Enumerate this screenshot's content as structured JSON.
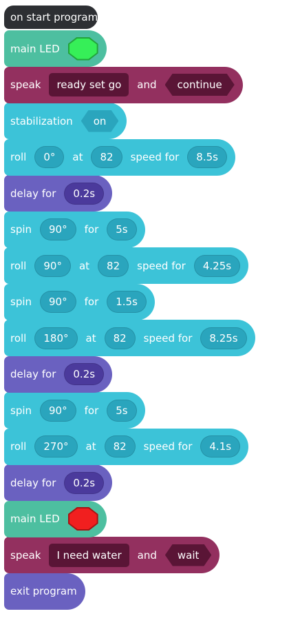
{
  "colors": {
    "event": "#2d2f33",
    "lights": "#4dbfa0",
    "sounds": "#93305f",
    "sounds_field": "#5a1536",
    "movement": "#3cc3d8",
    "movement_field": "#2aa5bd",
    "control": "#6a61c0",
    "control_field": "#4b3a9c",
    "green_led": "#36ef58",
    "green_led_border": "#22a33a",
    "red_led": "#f11f1f",
    "red_led_border": "#a81212"
  },
  "program": {
    "start_label": "on start program",
    "blocks": [
      {
        "id": "led1",
        "category": "lights",
        "parts": [
          {
            "t": "word",
            "v": "main LED"
          },
          {
            "t": "swatch",
            "color": "green_led",
            "border": "green_led_border",
            "icon": "green-led-swatch"
          }
        ]
      },
      {
        "id": "speak1",
        "category": "sounds",
        "parts": [
          {
            "t": "word",
            "v": "speak"
          },
          {
            "t": "str",
            "v": "ready set go"
          },
          {
            "t": "word",
            "v": "and"
          },
          {
            "t": "hex",
            "v": "continue"
          }
        ]
      },
      {
        "id": "stab",
        "category": "movement",
        "parts": [
          {
            "t": "word",
            "v": "stabilization"
          },
          {
            "t": "hex",
            "v": "on"
          }
        ]
      },
      {
        "id": "roll1",
        "category": "movement",
        "parts": [
          {
            "t": "word",
            "v": "roll"
          },
          {
            "t": "oval",
            "v": "0°"
          },
          {
            "t": "word",
            "v": "at"
          },
          {
            "t": "oval",
            "v": "82"
          },
          {
            "t": "word",
            "v": "speed for"
          },
          {
            "t": "oval",
            "v": "8.5s"
          }
        ]
      },
      {
        "id": "delay1",
        "category": "control",
        "parts": [
          {
            "t": "word",
            "v": "delay for"
          },
          {
            "t": "oval",
            "v": "0.2s"
          }
        ]
      },
      {
        "id": "spin1",
        "category": "movement",
        "parts": [
          {
            "t": "word",
            "v": "spin"
          },
          {
            "t": "oval",
            "v": "90°"
          },
          {
            "t": "word",
            "v": "for"
          },
          {
            "t": "oval",
            "v": "5s"
          }
        ]
      },
      {
        "id": "roll2",
        "category": "movement",
        "parts": [
          {
            "t": "word",
            "v": "roll"
          },
          {
            "t": "oval",
            "v": "90°"
          },
          {
            "t": "word",
            "v": "at"
          },
          {
            "t": "oval",
            "v": "82"
          },
          {
            "t": "word",
            "v": "speed for"
          },
          {
            "t": "oval",
            "v": "4.25s"
          }
        ]
      },
      {
        "id": "spin2",
        "category": "movement",
        "parts": [
          {
            "t": "word",
            "v": "spin"
          },
          {
            "t": "oval",
            "v": "90°"
          },
          {
            "t": "word",
            "v": "for"
          },
          {
            "t": "oval",
            "v": "1.5s"
          }
        ]
      },
      {
        "id": "roll3",
        "category": "movement",
        "parts": [
          {
            "t": "word",
            "v": "roll"
          },
          {
            "t": "oval",
            "v": "180°"
          },
          {
            "t": "word",
            "v": "at"
          },
          {
            "t": "oval",
            "v": "82"
          },
          {
            "t": "word",
            "v": "speed for"
          },
          {
            "t": "oval",
            "v": "8.25s"
          }
        ]
      },
      {
        "id": "delay2",
        "category": "control",
        "parts": [
          {
            "t": "word",
            "v": "delay for"
          },
          {
            "t": "oval",
            "v": "0.2s"
          }
        ]
      },
      {
        "id": "spin3",
        "category": "movement",
        "parts": [
          {
            "t": "word",
            "v": "spin"
          },
          {
            "t": "oval",
            "v": "90°"
          },
          {
            "t": "word",
            "v": "for"
          },
          {
            "t": "oval",
            "v": "5s"
          }
        ]
      },
      {
        "id": "roll4",
        "category": "movement",
        "parts": [
          {
            "t": "word",
            "v": "roll"
          },
          {
            "t": "oval",
            "v": "270°"
          },
          {
            "t": "word",
            "v": "at"
          },
          {
            "t": "oval",
            "v": "82"
          },
          {
            "t": "word",
            "v": "speed for"
          },
          {
            "t": "oval",
            "v": "4.1s"
          }
        ]
      },
      {
        "id": "delay3",
        "category": "control",
        "parts": [
          {
            "t": "word",
            "v": "delay for"
          },
          {
            "t": "oval",
            "v": "0.2s"
          }
        ]
      },
      {
        "id": "led2",
        "category": "lights",
        "parts": [
          {
            "t": "word",
            "v": "main LED"
          },
          {
            "t": "swatch",
            "color": "red_led",
            "border": "red_led_border",
            "icon": "red-led-swatch"
          }
        ]
      },
      {
        "id": "speak2",
        "category": "sounds",
        "parts": [
          {
            "t": "word",
            "v": "speak"
          },
          {
            "t": "str",
            "v": "I need water"
          },
          {
            "t": "word",
            "v": "and"
          },
          {
            "t": "hex",
            "v": "wait"
          }
        ]
      },
      {
        "id": "exit",
        "category": "control",
        "parts": [
          {
            "t": "word",
            "v": "exit program"
          }
        ]
      }
    ]
  }
}
